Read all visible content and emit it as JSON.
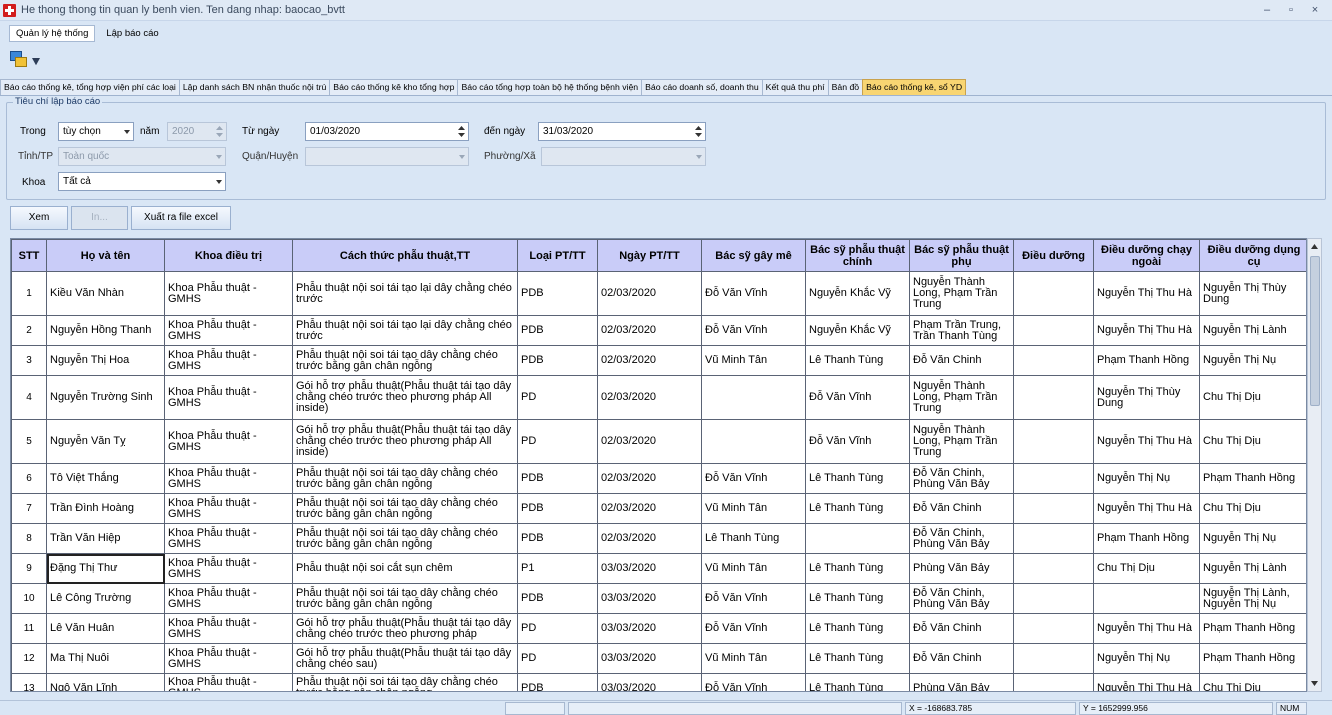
{
  "window": {
    "title": "He thong thong tin quan ly benh vien. Ten dang nhap: baocao_bvtt",
    "minimize": "–",
    "restore": "▫",
    "close": "×"
  },
  "menu": {
    "items": [
      {
        "label": "Quản lý hệ thống"
      },
      {
        "label": "Lập báo cáo"
      }
    ]
  },
  "tabs": [
    {
      "label": "Báo cáo thống kê, tổng hợp viện phí các loại"
    },
    {
      "label": "Lập danh sách BN nhận thuốc nội trú"
    },
    {
      "label": "Báo cáo thống kê kho tổng hợp"
    },
    {
      "label": "Báo cáo tổng hợp toàn bộ hệ thống bệnh viện"
    },
    {
      "label": "Báo cáo doanh số, doanh thu"
    },
    {
      "label": "Kết quả thu phí"
    },
    {
      "label": "Bản đồ"
    },
    {
      "label": "Báo cáo thống kê, sổ YD"
    }
  ],
  "criteria": {
    "legend": "Tiêu chí lập báo cáo",
    "trong_label": "Trong",
    "trong_value": "tùy chọn",
    "nam_label": "năm",
    "nam_value": "2020",
    "tu_ngay_label": "Từ ngày",
    "tu_ngay_value": "01/03/2020",
    "den_ngay_label": "đến ngày",
    "den_ngay_value": "31/03/2020",
    "tinh_label": "Tỉnh/TP",
    "tinh_value": "Toàn quốc",
    "quan_label": "Quận/Huyện",
    "quan_value": "",
    "phuong_label": "Phường/Xã",
    "phuong_value": "",
    "khoa_label": "Khoa",
    "khoa_value": "Tất cả"
  },
  "buttons": {
    "view": "Xem",
    "print": "In...",
    "export": "Xuất ra file excel"
  },
  "table": {
    "columns": [
      "STT",
      "Họ và tên",
      "Khoa điều trị",
      "Cách thức phẫu thuật,TT",
      "Loại PT/TT",
      "Ngày PT/TT",
      "Bác sỹ gây mê",
      "Bác sỹ phẫu thuật chính",
      "Bác sỹ phẫu thuật phụ",
      "Điều dưỡng",
      "Điều dưỡng chạy ngoài",
      "Điều dưỡng dụng cụ"
    ],
    "rows": [
      [
        "1",
        "Kiều Văn Nhàn",
        "Khoa Phẫu thuật - GMHS",
        "Phẫu thuật nội soi tái tạo lại dây chằng chéo trước",
        "PDB",
        "02/03/2020",
        "Đỗ Văn Vĩnh",
        "Nguyễn Khắc Vỹ",
        "Nguyễn Thành Long, Phạm Trần Trung",
        "",
        "Nguyễn Thị Thu Hà",
        "Nguyễn Thị Thùy Dung"
      ],
      [
        "2",
        "Nguyễn Hồng Thanh",
        "Khoa Phẫu thuật - GMHS",
        "Phẫu thuật nội soi tái tạo lại dây chằng chéo trước",
        "PDB",
        "02/03/2020",
        "Đỗ Văn Vĩnh",
        "Nguyễn Khắc Vỹ",
        "Phạm Trần Trung, Trần Thanh Tùng",
        "",
        "Nguyễn Thị Thu Hà",
        "Nguyễn Thị Lành"
      ],
      [
        "3",
        "Nguyễn Thị Hoa",
        "Khoa Phẫu thuật - GMHS",
        "Phẫu thuật nội soi tái tạo dây chằng chéo trước bằng gân chân ngỗng",
        "PDB",
        "02/03/2020",
        "Vũ Minh Tân",
        "Lê Thanh Tùng",
        "Đỗ Văn Chinh",
        "",
        "Phạm Thanh Hồng",
        "Nguyễn Thị Nụ"
      ],
      [
        "4",
        "Nguyễn Trường Sinh",
        "Khoa Phẫu thuật - GMHS",
        "Gói hỗ trợ phẫu thuật(Phẫu thuật tái tạo dây chằng chéo trước theo phương pháp All inside)",
        "PD",
        "02/03/2020",
        "",
        "Đỗ Văn Vĩnh",
        "Nguyễn Thành Long, Phạm Trần Trung",
        "",
        "Nguyễn Thị Thùy Dung",
        "Chu Thị Dịu"
      ],
      [
        "5",
        "Nguyễn Văn Tỵ",
        "Khoa Phẫu thuật - GMHS",
        "Gói hỗ trợ phẫu thuật(Phẫu thuật tái tạo dây chằng chéo trước theo phương pháp All inside)",
        "PD",
        "02/03/2020",
        "",
        "Đỗ Văn Vĩnh",
        "Nguyễn Thành Long, Phạm Trần Trung",
        "",
        "Nguyễn Thị Thu Hà",
        "Chu Thị Dịu"
      ],
      [
        "6",
        "Tô Việt Thắng",
        "Khoa Phẫu thuật - GMHS",
        "Phẫu thuật nội soi tái tạo dây chằng chéo trước bằng gân chân ngỗng",
        "PDB",
        "02/03/2020",
        "Đỗ Văn Vĩnh",
        "Lê Thanh Tùng",
        "Đỗ Văn Chinh, Phùng Văn Bảy",
        "",
        "Nguyễn Thị Nụ",
        "Phạm Thanh Hồng"
      ],
      [
        "7",
        "Trần Đình Hoàng",
        "Khoa Phẫu thuật - GMHS",
        "Phẫu thuật nội soi tái tạo dây chằng chéo trước bằng gân chân ngỗng",
        "PDB",
        "02/03/2020",
        "Vũ Minh Tân",
        "Lê Thanh Tùng",
        "Đỗ Văn Chinh",
        "",
        "Nguyễn Thị Thu Hà",
        "Chu Thị Dịu"
      ],
      [
        "8",
        "Trần Văn Hiệp",
        "Khoa Phẫu thuật - GMHS",
        "Phẫu thuật nội soi tái tạo dây chằng chéo trước bằng gân chân ngỗng",
        "PDB",
        "02/03/2020",
        "Lê Thanh Tùng",
        "",
        "Đỗ Văn Chinh, Phùng Văn Bảy",
        "",
        "Phạm Thanh Hồng",
        "Nguyễn Thị Nụ"
      ],
      [
        "9",
        "Đặng Thị Thư",
        "Khoa Phẫu thuật - GMHS",
        "Phẫu thuật nội soi cắt sụn chêm",
        "P1",
        "03/03/2020",
        "Vũ Minh Tân",
        "Lê Thanh Tùng",
        "Phùng Văn Bảy",
        "",
        "Chu Thị Dịu",
        "Nguyễn Thị Lành"
      ],
      [
        "10",
        "Lê Công Trường",
        "Khoa Phẫu thuật - GMHS",
        "Phẫu thuật nội soi tái tạo dây chằng chéo trước bằng gân chân ngỗng",
        "PDB",
        "03/03/2020",
        "Đỗ Văn Vĩnh",
        "Lê Thanh Tùng",
        "Đỗ Văn Chinh, Phùng Văn Bảy",
        "",
        "",
        "Nguyễn Thị Lành, Nguyễn Thị Nụ"
      ],
      [
        "11",
        "Lê Văn Huân",
        "Khoa Phẫu thuật - GMHS",
        "Gói hỗ trợ phẫu thuật(Phẫu thuật tái tạo dây chằng chéo trước theo phương pháp",
        "PD",
        "03/03/2020",
        "Đỗ Văn Vĩnh",
        "Lê Thanh Tùng",
        "Đỗ Văn Chinh",
        "",
        "Nguyễn Thị Thu Hà",
        "Phạm Thanh Hồng"
      ],
      [
        "12",
        "Ma Thị Nuôi",
        "Khoa Phẫu thuật - GMHS",
        "Gói hỗ trợ phẫu thuật(Phẫu thuật tái tạo dây chằng chéo sau)",
        "PD",
        "03/03/2020",
        "Vũ Minh Tân",
        "Lê Thanh Tùng",
        "Đỗ Văn Chinh",
        "",
        "Nguyễn Thị Nụ",
        "Phạm Thanh Hồng"
      ],
      [
        "13",
        "Ngô Văn Lĩnh",
        "Khoa Phẫu thuật - GMHS",
        "Phẫu thuật nội soi tái tạo dây chằng chéo trước bằng gân chân ngỗng",
        "PDB",
        "03/03/2020",
        "Đỗ Văn Vĩnh",
        "Lê Thanh Tùng",
        "Phùng Văn Bảy",
        "",
        "Nguyễn Thị Thu Hà",
        "Chu Thị Dịu"
      ]
    ]
  },
  "status": {
    "x": "X = -168683.785",
    "y": "Y = 1652999.956",
    "num": "NUM"
  },
  "colors": {
    "header_bg": "#c9ccf8",
    "active_tab": "#f8d572",
    "app_bg": "#d9e6f5"
  }
}
